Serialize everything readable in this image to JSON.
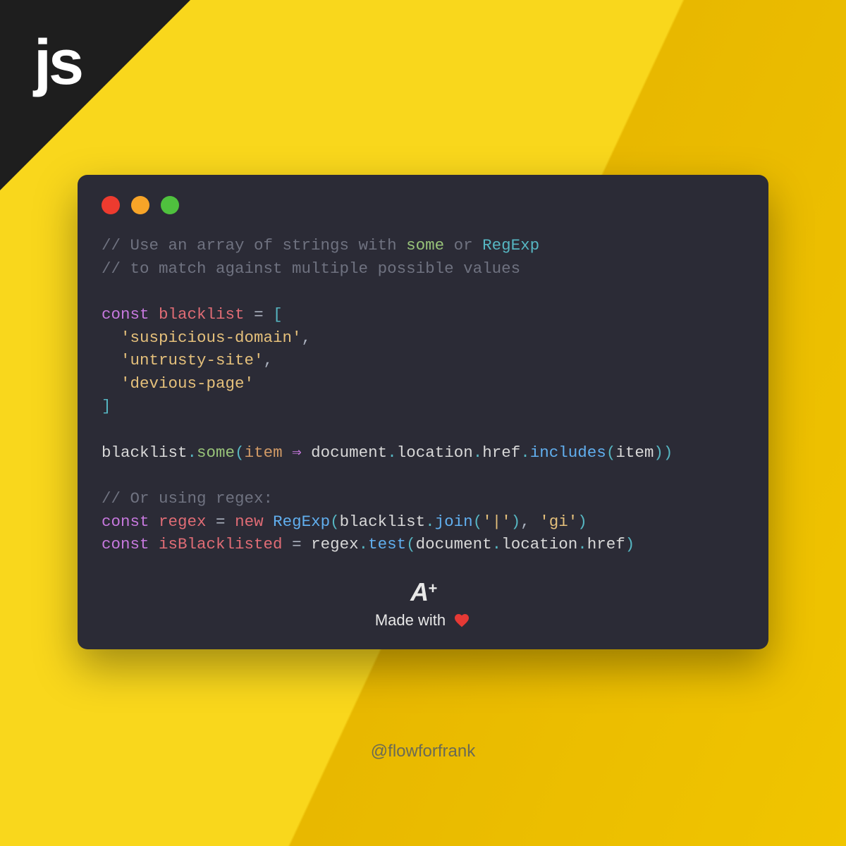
{
  "logo": "js",
  "colors": {
    "bg_yellow": "#f9d71c",
    "bg_yellow_dark": "#e8b800",
    "window_bg": "#2b2b36",
    "corner": "#1e1e1e",
    "red": "#ed3b2f",
    "yellow": "#f7a428",
    "green": "#4fc13e"
  },
  "code": {
    "comment1": "// Use an array of strings with ",
    "comment1_kw1": "some",
    "comment1_mid": " or ",
    "comment1_kw2": "RegExp",
    "comment2": "// to match against multiple possible values",
    "const": "const",
    "blacklist_var": "blacklist",
    "eq": " = ",
    "open_bracket": "[",
    "item1": "'suspicious-domain'",
    "item2": "'untrusty-site'",
    "item3": "'devious-page'",
    "close_bracket": "]",
    "comma": ",",
    "blacklist_call": "blacklist",
    "some_fn": "some",
    "item_param": "item",
    "arrow": " ⇒ ",
    "document": "document",
    "location": "location",
    "href": "href",
    "includes": "includes",
    "comment3": "// Or using regex:",
    "regex_var": "regex",
    "new_kw": "new",
    "regexp_class": "RegExp",
    "join_fn": "join",
    "pipe_str": "'|'",
    "gi_str": "'gi'",
    "isBlacklisted_var": "isBlacklisted",
    "test_fn": "test"
  },
  "badge": {
    "aplus_a": "A",
    "aplus_plus": "+",
    "made_with": "Made with"
  },
  "handle": "@flowforfrank"
}
